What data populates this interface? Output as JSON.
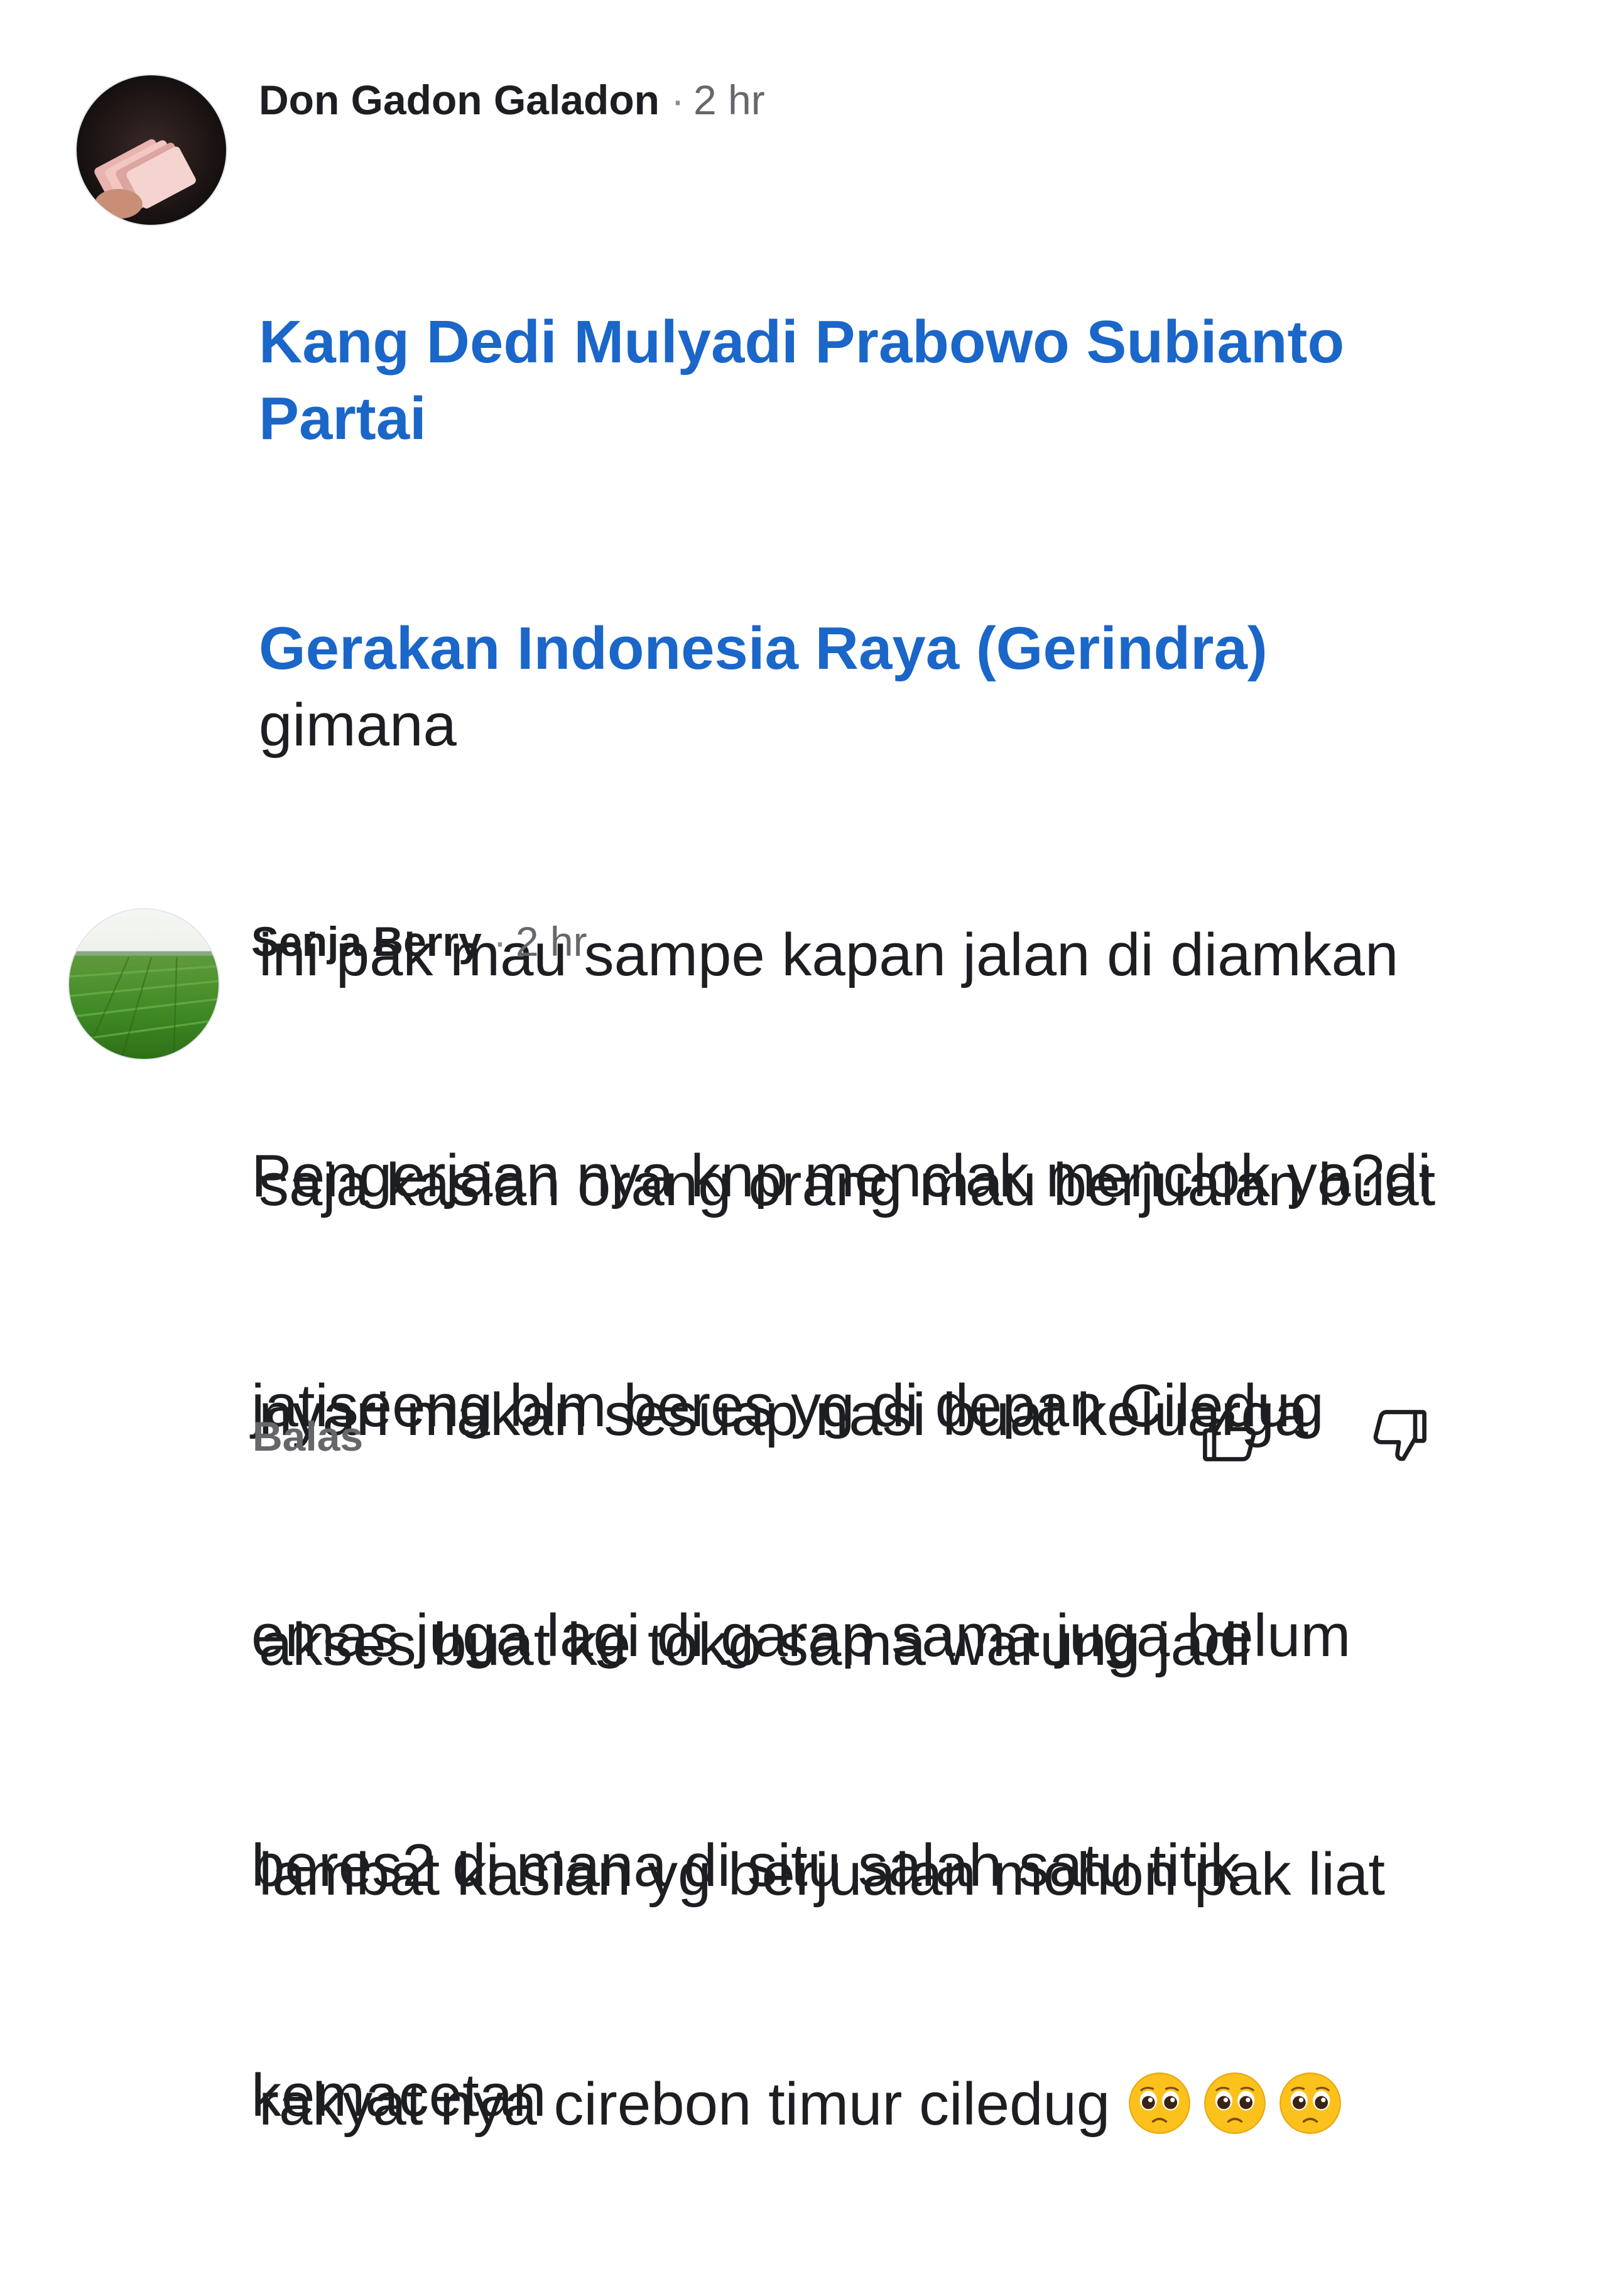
{
  "comments": [
    {
      "author": "Don Gadon Galadon",
      "separator": "·",
      "time": "2 hr",
      "avatar_icon": "money-photo-avatar",
      "mention_line1": "Kang Dedi Mulyadi Prabowo Subianto Partai",
      "mention_line2": "Gerakan Indonesia Raya (Gerindra)",
      "line2_rest": " gimana",
      "line3": "ini pak mau sampe kapan jalan di diamkan",
      "line4": "saja kasian orang orang mau berjualan buat",
      "line5": "nyari makan sesuap nasi buat keluarga",
      "line6": "akses buat ke toko sama warung jadi",
      "line7": "lambat kasian yg berjualan mohon pak liat",
      "line8": "rakyat nya cirebon timur ciledug ",
      "emojis": [
        "pleading-face-emoji",
        "pleading-face-emoji",
        "pleading-face-emoji"
      ]
    },
    {
      "author": "Senja Berry",
      "separator": "·",
      "time": "2 hr",
      "avatar_icon": "rice-field-photo-avatar",
      "line1": "Pengerjaan nya knp menclak menclok ya?di",
      "line2": "jatiseeng blm beres yg di depan Ciledug",
      "line3": "emas juga lagi di garap sama juga belum",
      "line4": "beres2 di mana di situ salah satu titik",
      "line5": "kemacetan",
      "reply_label": "Balas",
      "like_icon": "thumbs-up-icon",
      "dislike_icon": "thumbs-down-icon"
    }
  ],
  "colors": {
    "mention": "#1a66c9",
    "text": "#1c1e21",
    "secondary": "#65676b"
  }
}
